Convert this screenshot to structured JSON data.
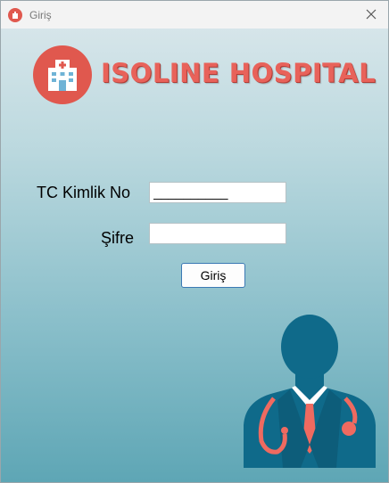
{
  "window": {
    "title": "Giriş",
    "close_glyph": "✕",
    "app_icon": "hospital-icon"
  },
  "header": {
    "logo_icon": "hospital-building-icon",
    "brand": "ISOLINE HOSPITAL"
  },
  "form": {
    "tc_label": "TC Kimlik No",
    "tc_value": "__________",
    "password_label": "Şifre",
    "password_value": "",
    "login_button": "Giriş"
  },
  "illustration": {
    "icon": "doctor-icon"
  },
  "colors": {
    "accent_red": "#e0584e",
    "doctor_blue": "#0f6a8a",
    "button_border": "#3b79b4"
  }
}
